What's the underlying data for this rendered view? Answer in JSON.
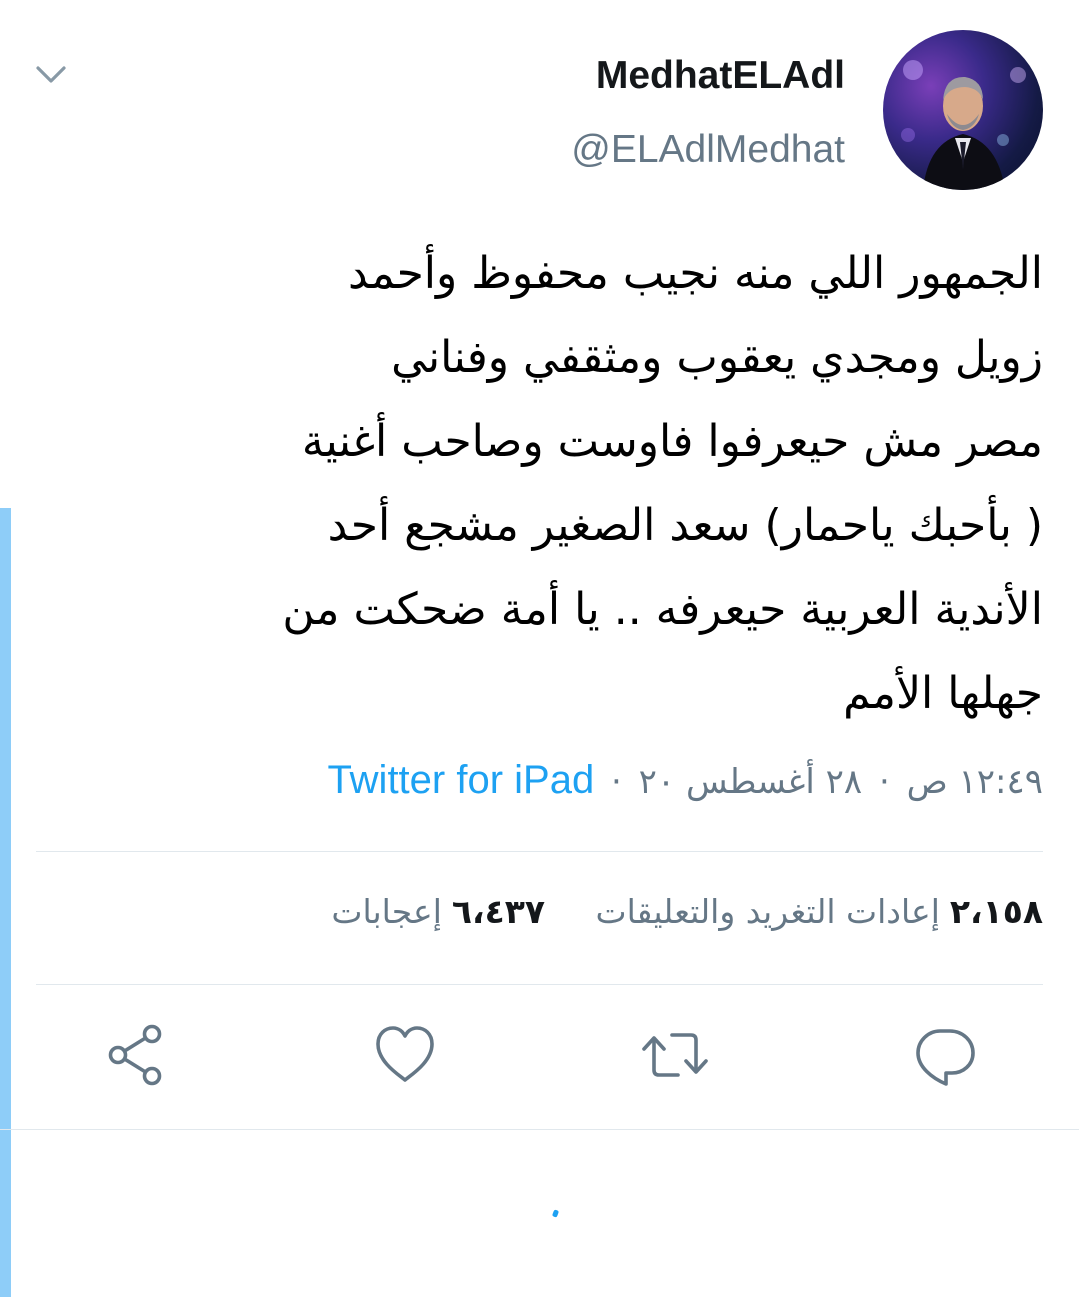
{
  "tweet": {
    "author": {
      "display_name": "MedhatELAdl",
      "handle": "@ELAdlMedhat"
    },
    "text_lines": [
      "الجمهور اللي منه نجيب محفوظ وأحمد",
      "زويل ومجدي يعقوب ومثقفي وفناني",
      "مصر مش حيعرفوا فاوست وصاحب أغنية",
      "( بأحبك ياحمار) سعد الصغير مشجع أحد",
      "الأندية العربية حيعرفه .. يا أمة ضحكت من",
      "جهلها الأمم"
    ],
    "time": "١٢:٤٩ ص",
    "date": "٢٨ أغسطس ٢٠",
    "separator": "·",
    "source": "Twitter for iPad",
    "stats": {
      "retweets_count": "٢،١٥٨",
      "retweets_label": "إعادات التغريد والتعليقات",
      "likes_count": "٦،٤٣٧",
      "likes_label": "إعجابات"
    }
  },
  "icons": {
    "menu": "chevron-down-icon",
    "reply": "reply-icon",
    "retweet": "retweet-icon",
    "like": "heart-icon",
    "share": "share-icon"
  },
  "colors": {
    "accent": "#1da1f2",
    "secondary_text": "#657786",
    "icon": "#657786",
    "divider": "#e1e8ed",
    "left_accent": "#8ecdf8"
  }
}
